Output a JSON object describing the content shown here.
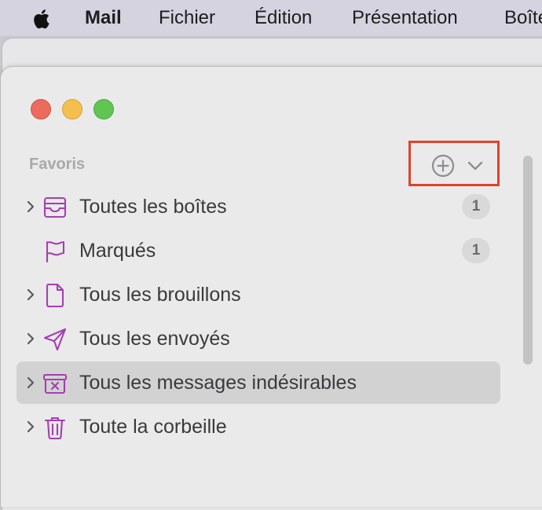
{
  "menubar": {
    "app_name": "Mail",
    "items": [
      "Fichier",
      "Édition",
      "Présentation",
      "Boîte"
    ]
  },
  "sidebar": {
    "section_title": "Favoris",
    "items": [
      {
        "label": "Toutes les boîtes",
        "icon": "inbox-tray-icon",
        "badge": "1",
        "expandable": true,
        "selected": false
      },
      {
        "label": "Marqués",
        "icon": "flag-icon",
        "badge": "1",
        "expandable": false,
        "selected": false
      },
      {
        "label": "Tous les brouillons",
        "icon": "document-icon",
        "badge": "",
        "expandable": true,
        "selected": false
      },
      {
        "label": "Tous les envoyés",
        "icon": "paper-plane-icon",
        "badge": "",
        "expandable": true,
        "selected": false
      },
      {
        "label": "Tous les messages indésirables",
        "icon": "junk-box-icon",
        "badge": "",
        "expandable": true,
        "selected": true
      },
      {
        "label": "Toute la corbeille",
        "icon": "trash-icon",
        "badge": "",
        "expandable": true,
        "selected": false
      }
    ]
  },
  "colors": {
    "accent": "#a53fb1",
    "highlight_box": "#e0432d",
    "selected_row": "#d3d2d3"
  }
}
